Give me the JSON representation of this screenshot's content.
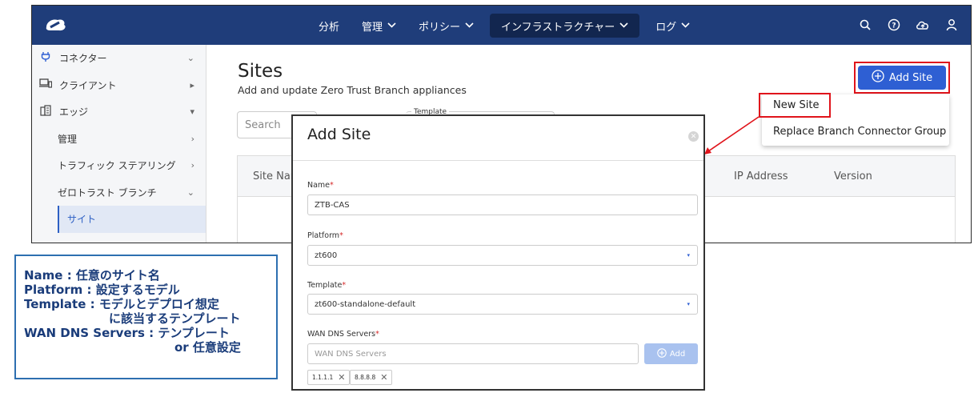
{
  "nav": {
    "items": [
      {
        "label": "分析",
        "chevron": false
      },
      {
        "label": "管理",
        "chevron": true
      },
      {
        "label": "ポリシー",
        "chevron": true
      },
      {
        "label": "インフラストラクチャー",
        "chevron": true,
        "active": true
      },
      {
        "label": "ログ",
        "chevron": true
      }
    ]
  },
  "sidebar": {
    "items": [
      {
        "label": "コネクター",
        "icon": "plug-icon",
        "caret": "⌄"
      },
      {
        "label": "クライアント",
        "icon": "devices-icon",
        "caret": "▸"
      },
      {
        "label": "エッジ",
        "icon": "building-icon",
        "caret": "▾"
      },
      {
        "label": "管理",
        "caret": "›"
      },
      {
        "label": "トラフィック ステアリング",
        "caret": "›"
      },
      {
        "label": "ゼロトラスト ブランチ",
        "caret": "⌄"
      },
      {
        "label": "サイト"
      }
    ]
  },
  "page": {
    "title": "Sites",
    "subtitle": "Add and update Zero Trust Branch appliances",
    "add_button": "Add Site",
    "search_placeholder": "Search",
    "template_legend": "Template"
  },
  "table": {
    "columns": [
      "Site Nar",
      "IP Address",
      "Version"
    ]
  },
  "dropdown": {
    "items": [
      "New Site",
      "Replace Branch Connector Group"
    ]
  },
  "modal": {
    "title": "Add Site",
    "name_label": "Name",
    "name_value": "ZTB-CAS",
    "platform_label": "Platform",
    "platform_value": "zt600",
    "template_label": "Template",
    "template_value": "zt600-standalone-default",
    "dns_label": "WAN DNS Servers",
    "dns_placeholder": "WAN DNS Servers",
    "dns_add": "Add",
    "tags": [
      "1.1.1.1",
      "8.8.8.8"
    ],
    "required_mark": "*"
  },
  "annotation": {
    "lines": [
      "Name : 任意のサイト名",
      "Platform : 設定するモデル",
      "Template : モデルとデプロイ想定",
      "に該当するテンプレート",
      "WAN DNS Servers : テンプレート",
      "or 任意設定"
    ]
  },
  "colors": {
    "topbar": "#1f3d7a",
    "accent": "#2e5fd3",
    "highlight": "#e0141b",
    "annotation": "#1a3c7a"
  }
}
